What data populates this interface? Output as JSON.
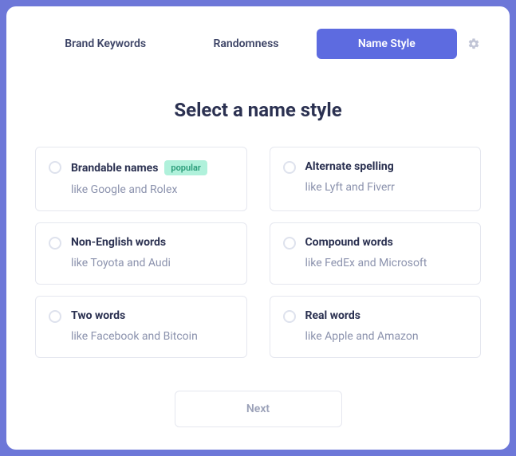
{
  "tabs": {
    "items": [
      {
        "label": "Brand Keywords",
        "active": false
      },
      {
        "label": "Randomness",
        "active": false
      },
      {
        "label": "Name Style",
        "active": true
      }
    ]
  },
  "heading": "Select a name style",
  "badge": {
    "popular": "popular"
  },
  "options": [
    {
      "title": "Brandable names",
      "desc": "like Google and Rolex",
      "badge": "popular"
    },
    {
      "title": "Alternate spelling",
      "desc": "like Lyft and Fiverr",
      "badge": null
    },
    {
      "title": "Non-English words",
      "desc": "like Toyota and Audi",
      "badge": null
    },
    {
      "title": "Compound words",
      "desc": "like FedEx and Microsoft",
      "badge": null
    },
    {
      "title": "Two words",
      "desc": "like Facebook and Bitcoin",
      "badge": null
    },
    {
      "title": "Real words",
      "desc": "like Apple and Amazon",
      "badge": null
    }
  ],
  "footer": {
    "next_label": "Next"
  }
}
